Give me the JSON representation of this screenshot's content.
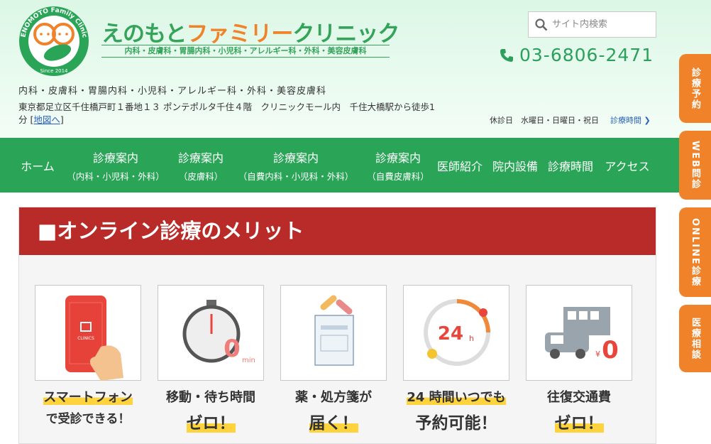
{
  "header": {
    "logo_ring_text": "ENOMOTO Family Clinic",
    "logo_since": "Since 2014",
    "brand_green": "えのもと",
    "brand_orange": "ファミリー",
    "brand_green2": "クリニック",
    "brand_sub": "内科・皮膚科・胃腸内科・小児科・アレルギー科・外科・美容皮膚科",
    "search_placeholder": "サイト内検索",
    "phone": "03-6806-2471",
    "departments": "内科・皮膚科・胃腸内科・小児科・アレルギー科・外科・美容皮膚科",
    "address": "東京都足立区千住橋戸町１番地１３ ポンテポルタ千住４階　クリニックモール内　千住大橋駅から徒歩1分",
    "map_link": "地図へ",
    "holiday": "休診日　水曜日・日曜日・祝日",
    "hours_link": "診療時間"
  },
  "nav": [
    {
      "main": "ホーム",
      "sub": ""
    },
    {
      "main": "診療案内",
      "sub": "（内科・小児科・外科）"
    },
    {
      "main": "診療案内",
      "sub": "（皮膚科）"
    },
    {
      "main": "診療案内",
      "sub": "（自費内科・小児科・外科）"
    },
    {
      "main": "診療案内",
      "sub": "（自費皮膚科）"
    },
    {
      "main": "医師紹介",
      "sub": ""
    },
    {
      "main": "院内設備",
      "sub": ""
    },
    {
      "main": "診療時間",
      "sub": ""
    },
    {
      "main": "アクセス",
      "sub": ""
    }
  ],
  "section": {
    "title": "■オンライン診療のメリット",
    "cards": [
      {
        "line1": "スマートフォン",
        "line2": "で受診できる！",
        "icon_text": "CLINICS"
      },
      {
        "line1": "移動・待ち時間",
        "line2": "ゼロ！",
        "icon_text": "0",
        "icon_sub": "min"
      },
      {
        "line1": "薬・処方箋が",
        "line2": "届く！"
      },
      {
        "line1": "24 時間いつでも",
        "line2": "予約可能！",
        "icon_text": "24",
        "icon_sub": "h"
      },
      {
        "line1": "往復交通費",
        "line2": "ゼロ！",
        "icon_text": "0",
        "icon_sub": "¥"
      }
    ]
  },
  "float_buttons": [
    "診療予約",
    "WEB問診",
    "ONLINE診療",
    "医療相談"
  ],
  "colors": {
    "green": "#2aa557",
    "orange": "#f0832a",
    "red": "#b82b28",
    "yellow": "#ffd33e",
    "link": "#2a62b8"
  }
}
